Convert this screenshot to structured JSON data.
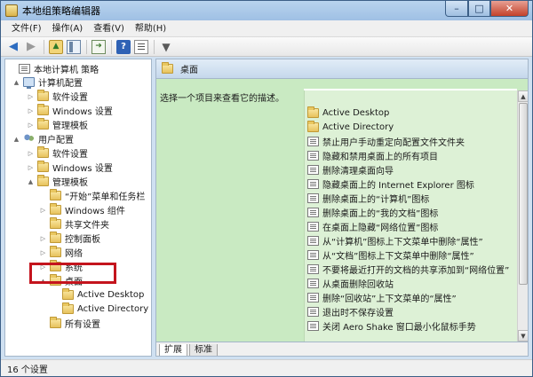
{
  "window": {
    "title": "本地组策略编辑器",
    "controls": {
      "minimize": "–",
      "maximize": "□",
      "close": "✕"
    }
  },
  "menubar": {
    "items": [
      "文件(F)",
      "操作(A)",
      "查看(V)",
      "帮助(H)"
    ]
  },
  "toolbar": {
    "buttons": [
      "back-icon",
      "forward-icon",
      "up-folder-icon",
      "show-hide-tree-icon",
      "export-list-icon",
      "help-icon",
      "properties-icon",
      "filter-icon"
    ]
  },
  "tree": {
    "items": [
      {
        "label": "本地计算机 策略",
        "level": 0,
        "icon": "policy-icon",
        "expander": ""
      },
      {
        "label": "计算机配置",
        "level": 1,
        "icon": "computer-icon",
        "expander": "▲"
      },
      {
        "label": "软件设置",
        "level": 2,
        "icon": "folder-icon",
        "expander": "▷"
      },
      {
        "label": "Windows 设置",
        "level": 2,
        "icon": "folder-icon",
        "expander": "▷"
      },
      {
        "label": "管理模板",
        "level": 2,
        "icon": "folder-icon",
        "expander": "▷"
      },
      {
        "label": "用户配置",
        "level": 1,
        "icon": "users-icon",
        "expander": "▲"
      },
      {
        "label": "软件设置",
        "level": 2,
        "icon": "folder-icon",
        "expander": "▷"
      },
      {
        "label": "Windows 设置",
        "level": 2,
        "icon": "folder-icon",
        "expander": "▷"
      },
      {
        "label": "管理模板",
        "level": 2,
        "icon": "folder-icon",
        "expander": "▲"
      },
      {
        "label": "“开始”菜单和任务栏",
        "level": 3,
        "icon": "folder-icon",
        "expander": ""
      },
      {
        "label": "Windows 组件",
        "level": 3,
        "icon": "folder-icon",
        "expander": "▷"
      },
      {
        "label": "共享文件夹",
        "level": 3,
        "icon": "folder-icon",
        "expander": ""
      },
      {
        "label": "控制面板",
        "level": 3,
        "icon": "folder-icon",
        "expander": "▷"
      },
      {
        "label": "网络",
        "level": 3,
        "icon": "folder-icon",
        "expander": "▷"
      },
      {
        "label": "系统",
        "level": 3,
        "icon": "folder-icon",
        "expander": "▷"
      },
      {
        "label": "桌面",
        "level": 2,
        "icon": "folder-icon",
        "expander": "▲"
      },
      {
        "label": "Active Desktop",
        "level": 3,
        "icon": "folder-icon",
        "expander": ""
      },
      {
        "label": "Active Directory",
        "level": 3,
        "icon": "folder-icon",
        "expander": ""
      },
      {
        "label": "所有设置",
        "level": 2,
        "icon": "folder-icon",
        "expander": ""
      }
    ]
  },
  "right_pane": {
    "header_title": "桌面",
    "description": "选择一个项目来查看它的描述。",
    "column_header": "设置",
    "items": [
      {
        "label": "Active Desktop",
        "icon": "folder-icon"
      },
      {
        "label": "Active Directory",
        "icon": "folder-icon"
      },
      {
        "label": "禁止用户手动重定向配置文件文件夹",
        "icon": "policy-icon"
      },
      {
        "label": "隐藏和禁用桌面上的所有项目",
        "icon": "policy-icon"
      },
      {
        "label": "删除清理桌面向导",
        "icon": "policy-icon"
      },
      {
        "label": "隐藏桌面上的 Internet Explorer 图标",
        "icon": "policy-icon"
      },
      {
        "label": "删除桌面上的“计算机”图标",
        "icon": "policy-icon"
      },
      {
        "label": "删除桌面上的“我的文档”图标",
        "icon": "policy-icon"
      },
      {
        "label": "在桌面上隐藏“网络位置”图标",
        "icon": "policy-icon"
      },
      {
        "label": "从“计算机”图标上下文菜单中删除“属性”",
        "icon": "policy-icon"
      },
      {
        "label": "从“文档”图标上下文菜单中删除“属性”",
        "icon": "policy-icon"
      },
      {
        "label": "不要将最近打开的文档的共享添加到“网络位置”",
        "icon": "policy-icon"
      },
      {
        "label": "从桌面删除回收站",
        "icon": "policy-icon"
      },
      {
        "label": "删除“回收站”上下文菜单的“属性”",
        "icon": "policy-icon"
      },
      {
        "label": "退出时不保存设置",
        "icon": "policy-icon"
      },
      {
        "label": "关闭 Aero Shake 窗口最小化鼠标手势",
        "icon": "policy-icon"
      }
    ],
    "tabs": [
      "扩展",
      "标准"
    ]
  },
  "statusbar": {
    "text": "16 个设置"
  }
}
